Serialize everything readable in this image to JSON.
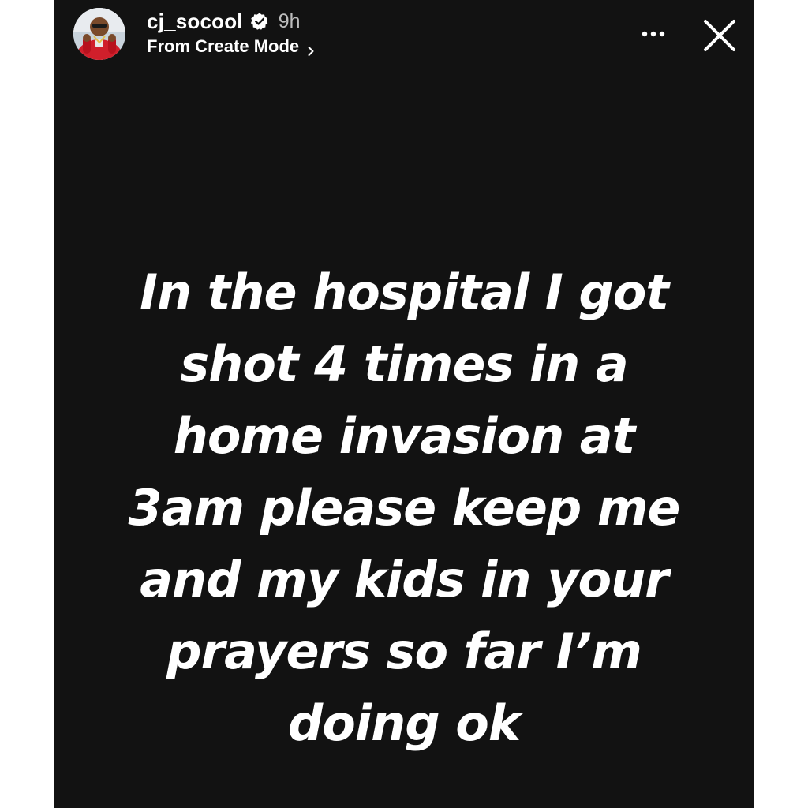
{
  "story": {
    "username": "cj_socool",
    "time_ago": "9h",
    "source_label": "From Create Mode",
    "text_lines": [
      "In the hospital I got",
      "shot 4 times in a",
      "home invasion at",
      "3am please keep me",
      "and my kids in your",
      "prayers so far I’m",
      "doing ok"
    ]
  },
  "icons": {
    "verified": "verified-badge-icon",
    "chevron": "chevron-right-icon",
    "more": "more-options-icon",
    "close": "close-icon"
  },
  "colors": {
    "story_background": "#121212",
    "page_background": "#ffffff",
    "text": "#ffffff",
    "time_text": "#bdbdbd",
    "avatar_outfit": "#d01f2b"
  }
}
